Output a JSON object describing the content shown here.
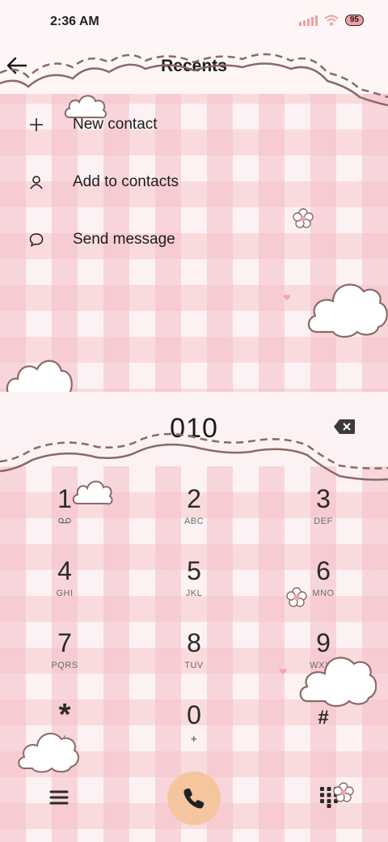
{
  "status_bar": {
    "time": "2:36 AM",
    "battery": "95"
  },
  "header": {
    "title": "Recents"
  },
  "menu": [
    {
      "icon": "plus-icon",
      "label": "New contact"
    },
    {
      "icon": "person-icon",
      "label": "Add to contacts"
    },
    {
      "icon": "message-icon",
      "label": "Send message"
    }
  ],
  "dial_input": {
    "number": "010"
  },
  "keypad": [
    [
      {
        "digit": "1",
        "sub": ""
      },
      {
        "digit": "2",
        "sub": "ABC"
      },
      {
        "digit": "3",
        "sub": "DEF"
      }
    ],
    [
      {
        "digit": "4",
        "sub": "GHI"
      },
      {
        "digit": "5",
        "sub": "JKL"
      },
      {
        "digit": "6",
        "sub": "MNO"
      }
    ],
    [
      {
        "digit": "7",
        "sub": "PQRS"
      },
      {
        "digit": "8",
        "sub": "TUV"
      },
      {
        "digit": "9",
        "sub": "WXYZ"
      }
    ],
    [
      {
        "digit": "*",
        "sub": ","
      },
      {
        "digit": "0",
        "sub": "+"
      },
      {
        "digit": "#",
        "sub": ""
      }
    ]
  ],
  "colors": {
    "accent_call": "#f5c59f",
    "outline": "#8a6a66",
    "gingham": "#f4bec6"
  }
}
